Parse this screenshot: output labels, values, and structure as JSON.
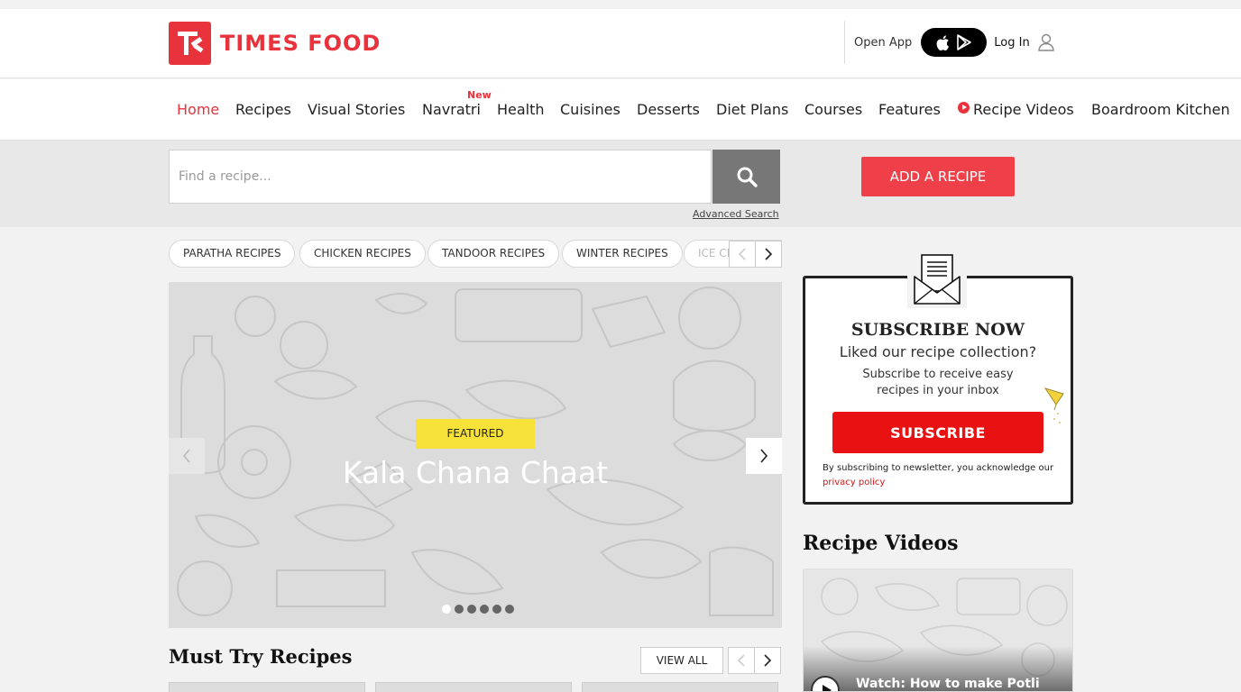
{
  "brand": {
    "name": "TIMES FOOD",
    "accent": "#e8323c"
  },
  "header": {
    "open_app": "Open App",
    "login": "Log In"
  },
  "nav": {
    "items": [
      "Home",
      "Recipes",
      "Visual Stories",
      "Navratri",
      "Health",
      "Cuisines",
      "Desserts",
      "Diet Plans",
      "Courses",
      "Features",
      "Recipe Videos",
      "Boardroom Kitchen"
    ],
    "new_badge": "New",
    "active": "Home"
  },
  "search": {
    "placeholder": "Find a recipe...",
    "advanced": "Advanced Search",
    "add_recipe": "ADD A RECIPE"
  },
  "chips": [
    "PARATHA RECIPES",
    "CHICKEN RECIPES",
    "TANDOOR RECIPES",
    "WINTER RECIPES",
    "ICE CREAM RECIPES"
  ],
  "hero": {
    "tag": "FEATURED",
    "title": "Kala Chana Chaat",
    "slides": 6,
    "active_slide": 1
  },
  "must_try": {
    "title": "Must Try Recipes",
    "view_all": "VIEW ALL"
  },
  "subscribe": {
    "heading": "SUBSCRIBE NOW",
    "subheading": "Liked our recipe collection?",
    "description": "Subscribe to receive easy recipes in your inbox",
    "button": "SUBSCRIBE",
    "note": "By subscribing to newsletter, you acknowledge our",
    "policy_link": "privacy policy"
  },
  "recipe_videos": {
    "title": "Recipe Videos",
    "caption": "Watch: How to make Potli"
  }
}
